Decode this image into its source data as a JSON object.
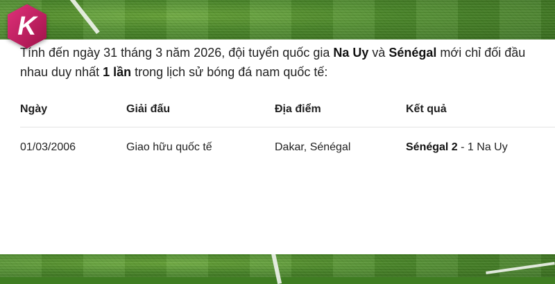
{
  "logo": {
    "letter": "K",
    "color": "#c0195c"
  },
  "intro": {
    "line1_pre": "Tính đến ngày 31 tháng 3 năm 2026, đội tuyển quốc gia ",
    "team_a": "Na Uy",
    "line1_mid": " và ",
    "team_b": "Sénégal",
    "line1_post": " mới chỉ đối đầu",
    "line2_pre": "nhau duy nhất ",
    "times": "1 lần",
    "line2_post": " trong lịch sử bóng đá nam quốc tế:"
  },
  "table": {
    "headers": [
      "Ngày",
      "Giải đấu",
      "Địa điểm",
      "Kết quả"
    ],
    "rows": [
      {
        "date": "01/03/2006",
        "competition": "Giao hữu quốc tế",
        "venue": "Dakar, Sénégal",
        "winner_score": "Sénégal 2",
        "rest": " - 1 Na Uy"
      }
    ]
  }
}
